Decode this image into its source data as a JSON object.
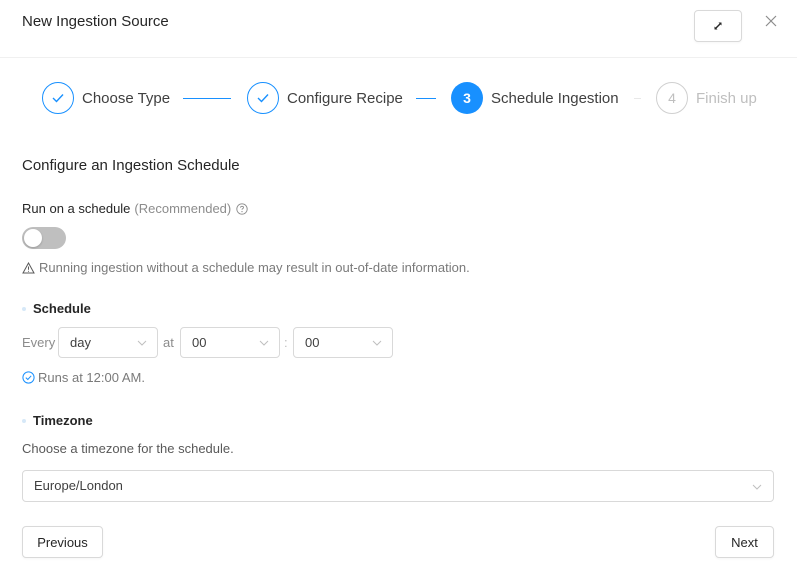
{
  "modal": {
    "title": "New Ingestion Source",
    "expand_icon": "expand-arrows-icon",
    "close_icon": "close-x-icon"
  },
  "steps": [
    {
      "number": "1",
      "label": "Choose Type",
      "status": "done"
    },
    {
      "number": "2",
      "label": "Configure Recipe",
      "status": "done"
    },
    {
      "number": "3",
      "label": "Schedule Ingestion",
      "status": "active"
    },
    {
      "number": "4",
      "label": "Finish up",
      "status": "wait"
    }
  ],
  "colors": {
    "accent": "#1890ff",
    "text": "#262626",
    "muted": "#8c8c8c",
    "border": "#d9d9d9",
    "toggle_off": "#bfbfbf"
  },
  "form": {
    "section_title": "Configure an Ingestion Schedule",
    "run_on_schedule": {
      "label": "Run on a schedule",
      "hint": "(Recommended)",
      "enabled": false
    },
    "warning": "Running ingestion without a schedule may result in out-of-date information.",
    "schedule": {
      "label": "Schedule",
      "every_label": "Every",
      "frequency": "day",
      "at_label": "at",
      "hour": "00",
      "separator": ":",
      "minute": "00",
      "runs_at": "Runs at 12:00 AM."
    },
    "timezone": {
      "label": "Timezone",
      "help": "Choose a timezone for the schedule.",
      "value": "Europe/London"
    }
  },
  "footer": {
    "previous_label": "Previous",
    "next_label": "Next"
  }
}
